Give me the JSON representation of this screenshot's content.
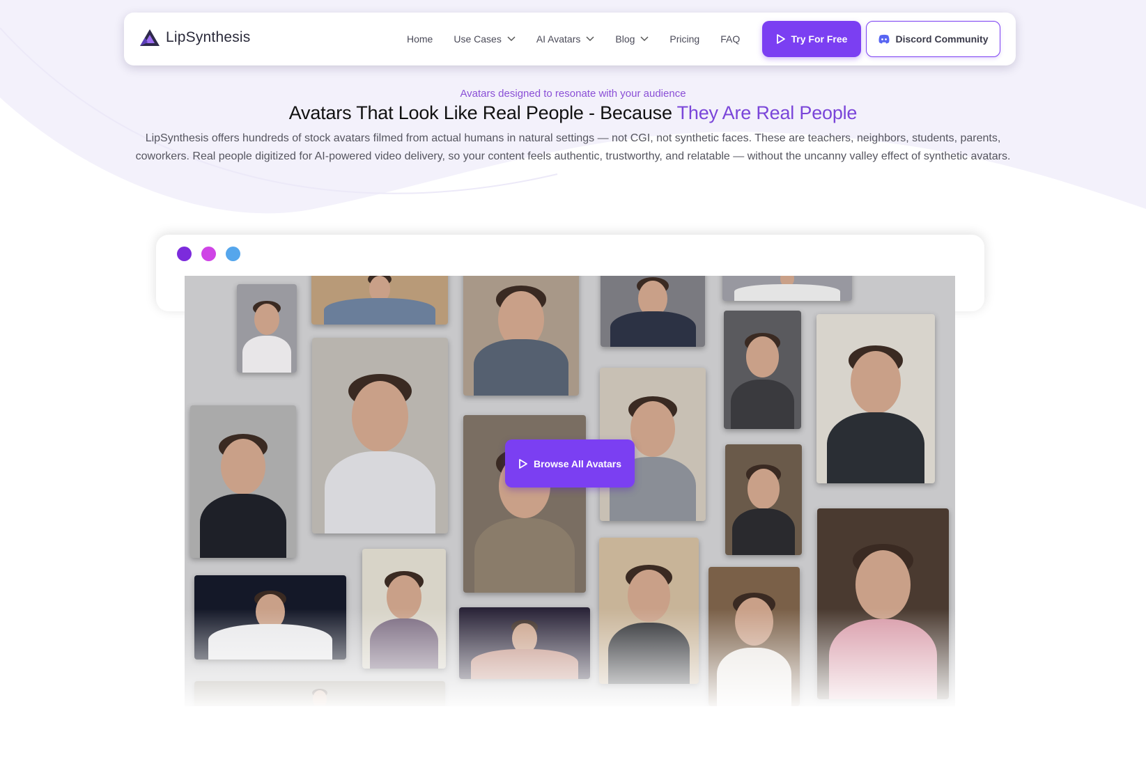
{
  "header": {
    "logo_text": "LipSynthesis",
    "nav": [
      {
        "label": "Home",
        "has_dropdown": false
      },
      {
        "label": "Use Cases",
        "has_dropdown": true
      },
      {
        "label": "AI Avatars",
        "has_dropdown": true
      },
      {
        "label": "Blog",
        "has_dropdown": true
      },
      {
        "label": "Pricing",
        "has_dropdown": false
      },
      {
        "label": "FAQ",
        "has_dropdown": false
      }
    ],
    "try_button": "Try For Free",
    "discord_button": "Discord Community"
  },
  "hero": {
    "eyebrow": "Avatars designed to resonate with your audience",
    "headline_plain": "Avatars That Look Like Real People - Because ",
    "headline_accent": "They Are Real People",
    "description": "LipSynthesis offers hundreds of stock avatars filmed from actual humans in natural settings — not CGI, not synthetic faces. These are teachers, neighbors, students, parents, coworkers. Real people digitized for AI-powered video delivery, so your content feels authentic, trustworthy, and relatable — without the uncanny valley effect of synthetic avatars."
  },
  "showcase": {
    "browse_button": "Browse All Avatars",
    "window_dots": [
      "#7c2bdc",
      "#cf44e6",
      "#55a6ec"
    ]
  },
  "colors": {
    "accent": "#7b3ff2",
    "eyebrow": "#8a4fd6",
    "headline_accent": "#7a45d9"
  }
}
